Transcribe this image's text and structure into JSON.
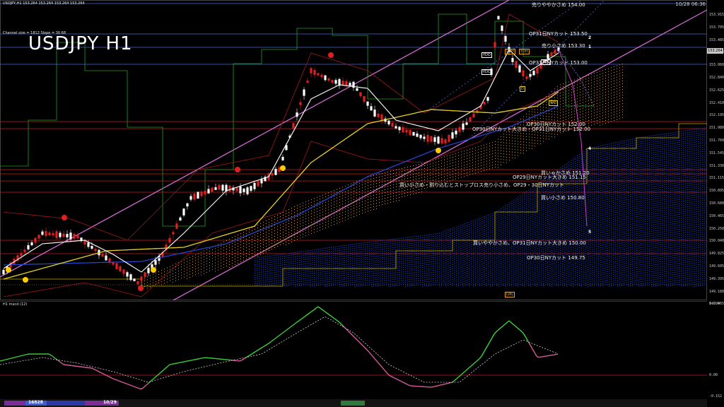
{
  "header": {
    "symbol_line": "USDJPY,H1  153.264 153.264 153.264 153.264",
    "title": "USDJPY H1",
    "channel_info": "Channel size = 1812 Slope = 30.68",
    "datetime": "10/28 06:36 ",
    "macd_header": "H1  macd (12)"
  },
  "price_axis": {
    "labels": [
      "153.915",
      "153.705",
      "153.485",
      "153.264",
      "153.060",
      "152.840",
      "152.625",
      "152.410",
      "152.195",
      "151.980",
      "151.760",
      "151.545",
      "151.330",
      "151.115",
      "150.895",
      "150.680",
      "150.465",
      "150.250",
      "150.040",
      "149.825",
      "149.605",
      "149.395",
      "149.180",
      "148.965"
    ],
    "current_price": "153.264",
    "current_color": "#c8c8c8"
  },
  "macd_axis": {
    "top": "0.594",
    "zero": "0.00",
    "bottom": "-0.152"
  },
  "levels": [
    {
      "label": "売りややかさめ 154.00",
      "color": "#4a7ad8"
    },
    {
      "label": "OP31日NYカット 153.50",
      "color": "#4a7ad8"
    },
    {
      "label": "売り小さめ 153.30",
      "color": "#4a7ad8"
    },
    {
      "label": "OP31日NYカット 153.00",
      "color": "#4a7ad8"
    },
    {
      "label": "OP30日NYカット 152.00",
      "color": "#d02020"
    },
    {
      "label": "OP30日NYカット大きめ・OP31日NYカット 152.00",
      "color": "#d02020"
    },
    {
      "label": "OP29日NYカット大きめ 151.15",
      "color": "#d02020"
    },
    {
      "label": "買いゃかさめ 151.20",
      "color": "#d02020"
    },
    {
      "label": "買い小さめ・割り込むとストップロス売り小さめ、OP29・30日NYカット",
      "color": "#d02020"
    },
    {
      "label": "買い小さめ 150.80",
      "color": "#d02020"
    },
    {
      "label": "買いややかさめ、OP31日NYカット大きめ 150.00",
      "color": "#d02020"
    },
    {
      "label": "OP30日NYカット 149.75",
      "color": "#d02020"
    }
  ],
  "wave_labels": [
    "1",
    "2",
    "4",
    "5"
  ],
  "tags": [
    "YDO",
    "YDC",
    "LWH",
    "YDH",
    "YDC",
    "WO",
    "LWL",
    "D"
  ],
  "bottom_bar": {
    "left_label": "16828",
    "center_label": "10/29"
  },
  "colors": {
    "bull": "#ffffff",
    "bear": "#e02020",
    "channel": "#e070e0",
    "tenkan": "#ffffff",
    "ma_yellow": "#e8d020",
    "ma_blue": "#2244cc",
    "cloud_blue": "#1a3cc0",
    "macd_up": "#3cd13c",
    "macd_down": "#d85a9a"
  }
}
